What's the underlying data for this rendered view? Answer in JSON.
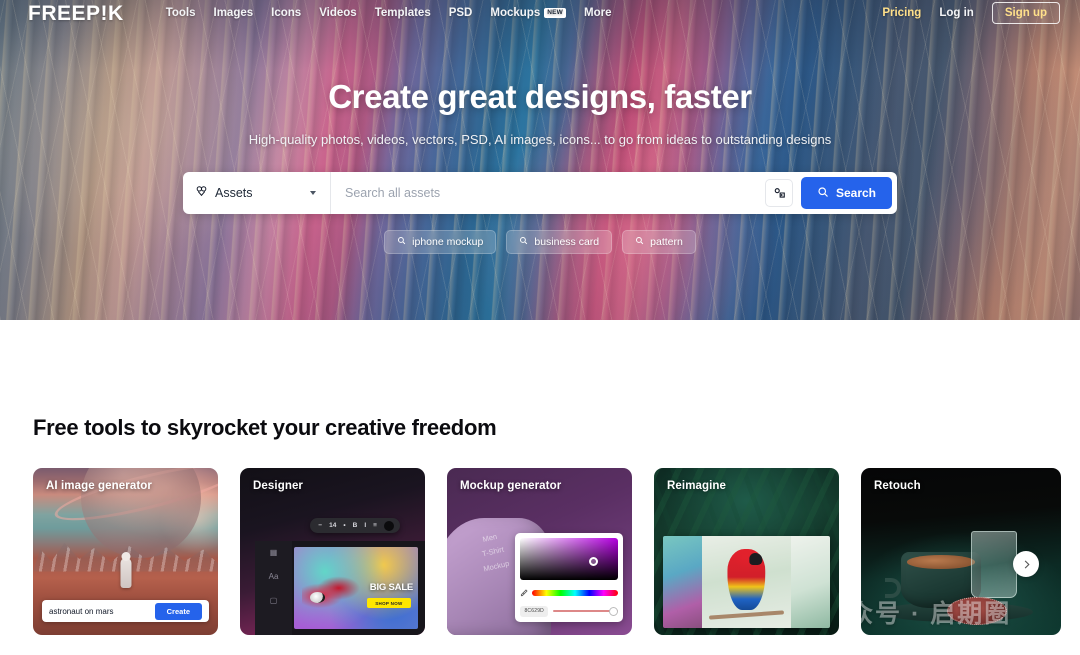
{
  "header": {
    "logo": "FREEP!K",
    "nav_items": [
      {
        "label": "Tools",
        "badge": ""
      },
      {
        "label": "Images",
        "badge": ""
      },
      {
        "label": "Icons",
        "badge": ""
      },
      {
        "label": "Videos",
        "badge": ""
      },
      {
        "label": "Templates",
        "badge": ""
      },
      {
        "label": "PSD",
        "badge": ""
      },
      {
        "label": "Mockups",
        "badge": "NEW"
      },
      {
        "label": "More",
        "badge": ""
      }
    ],
    "pricing": "Pricing",
    "login": "Log in",
    "signup": "Sign up",
    "accent_pricing_color": "#ffe08a"
  },
  "hero": {
    "title": "Create great designs, faster",
    "subtitle": "High-quality photos, videos, vectors, PSD, AI images, icons... to go from ideas to outstanding designs",
    "search": {
      "scope_label": "Assets",
      "scope_icon": "assets-icon",
      "placeholder": "Search all assets",
      "value": "",
      "tools_icon": "image-search-icon",
      "button_label": "Search",
      "button_color": "#2563eb"
    },
    "chips": [
      {
        "label": "iphone mockup"
      },
      {
        "label": "business card"
      },
      {
        "label": "pattern"
      }
    ]
  },
  "tools_section": {
    "title": "Free tools to skyrocket your creative freedom",
    "next_label": "›",
    "cards": [
      {
        "id": "ai-image-generator",
        "title": "AI image generator",
        "prompt_value": "astronaut on mars",
        "cta_label": "Create",
        "cta_color": "#2563eb"
      },
      {
        "id": "designer",
        "title": "Designer",
        "canvas_headline": "BIG SALE",
        "canvas_cta": "SHOP NOW",
        "toolbar_font_size": "14",
        "toolbar_items": [
          "−",
          "14",
          "•",
          "B",
          "I",
          "≡"
        ]
      },
      {
        "id": "mockup-generator",
        "title": "Mockup generator",
        "shirt_text": "Men\nT-Shirt\nMockup",
        "hex_value": "8C629D"
      },
      {
        "id": "reimagine",
        "title": "Reimagine"
      },
      {
        "id": "retouch",
        "title": "Retouch"
      }
    ]
  },
  "watermark": {
    "text": "公众号 · 启期圈"
  }
}
